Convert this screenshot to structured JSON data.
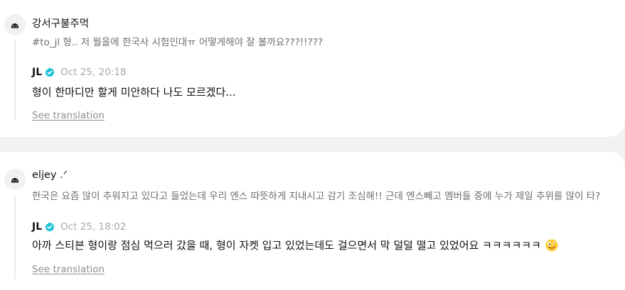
{
  "posts": [
    {
      "author": "강서구불주먹",
      "question": "#to_jl 형.. 저 월을에 한국사 시험인대ㅠ 어떻게해야 잘 볼까요???!!???",
      "reply": {
        "author": "JL",
        "time": "Oct 25, 20:18",
        "text": "형이 한마디만 할게 미안하다 나도 모르겠다..."
      },
      "translation_link": "See translation"
    },
    {
      "author": "eljey .ᐟ",
      "question": "한국은 요즘 많이 추워지고 있다고 들었는데 우리 엔스 따뜻하게 지내시고 감기 조심해!! 근데 엔스빼고 멤버들 중에 누가 제일 추위를 많이 타?",
      "reply": {
        "author": "JL",
        "time": "Oct 25, 18:02",
        "text": "아까 스티븐 형이랑 점심 먹으러 갔을 때, 형이 자켓 입고 있었는데도 걸으면서 막 덜덜 떨고 있었어요 ㅋㅋㅋㅋㅋㅋ"
      },
      "translation_link": "See translation"
    }
  ],
  "icons": {
    "avatar": "anonymous-avatar-icon",
    "verified": "verified-badge-icon",
    "emoji": "zany-face-emoji-icon"
  },
  "colors": {
    "background": "#f2f2f2",
    "card": "#ffffff",
    "verified": "#1fc2d6",
    "muted": "#8e8e8e"
  }
}
